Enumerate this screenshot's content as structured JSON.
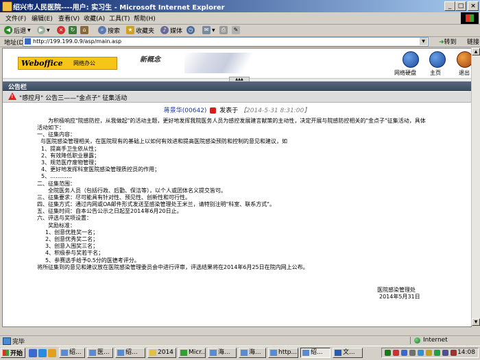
{
  "window": {
    "title": "绍兴市人民医院----用户: 实习生 - Microsoft Internet Explorer",
    "controls": [
      "_",
      "□",
      "×"
    ]
  },
  "menu": [
    "文件(F)",
    "编辑(E)",
    "查看(V)",
    "收藏(A)",
    "工具(T)",
    "帮助(H)"
  ],
  "toolbar": {
    "back": "后退",
    "search": "搜索",
    "favorites": "收藏夹",
    "media": "媒体"
  },
  "address": {
    "label": "地址(D)",
    "url": "http://199.199.0.9/asp/main.asp",
    "go": "转到",
    "links": "链接"
  },
  "banner": {
    "logo": "Weboffice",
    "logo_sub": "网络办公",
    "slogan": "新概念",
    "icons": [
      {
        "label": "网络硬盘",
        "icon": "disk-icon"
      },
      {
        "label": "主页",
        "icon": "home-icon"
      },
      {
        "label": "退出",
        "icon": "exit-icon"
      }
    ]
  },
  "bulletin": {
    "header": "公告栏",
    "subject": "\"感控月\" 公告三——\"金点子\" 征集活动",
    "author": "蒋景华(00642)",
    "published_label": "发表于",
    "date": "【2014-5-31 8:31:00】",
    "body": [
      "为积极响应\"院感防控，从我做起\"的活动主题，更好地发挥我院医务人员为感控发展建言献策的主动性，决定开展与院感防控相关的\"金点子\"征集活动，具体",
      "活动如下：",
      "一、征集内容：",
      "与医院感染管理相关，在医院现有的基础上以如何有效进和提高医院感染预防和控制的意见和建议，如",
      "1、提高手卫生依从性；",
      "2、有效降低职业暴露；",
      "3、规范医疗废物管理；",
      "4、更好地发挥科室医院感染管理质控员的作用；",
      "5、…………",
      "二、征集范围：",
      "全院医务人员（包括行政、后勤、保洁等），以个人或团体名义提交皆可。",
      "三、征集要求：尽可能具有针对性、预见性、创新性和可行性。",
      "四、征集方式：通过内网或OA邮件形式发送至感染管理处王米兰，请特别注明\"科室、联系方式\"。",
      "五、征集时间：自本公告公示之日起至2014年6月20日止。",
      "六、评选与奖项设置：",
      "奖励标准：",
      "1、创意优胜奖一名；",
      "2、创意优秀奖二名；",
      "3、创意入围奖三名；",
      "4、积极参与奖若干名；",
      "5、参赛选手给予0.5分的医德考评分。",
      "将所征集到的意见和建议放在医院感染管理委员会中进行评审，评选结果将在2014年6月25日在院内网上公布。"
    ],
    "signature": "医院感染管理处",
    "sign_date": "2014年5月31日"
  },
  "status": {
    "text": "完毕",
    "zone": "Internet"
  },
  "taskbar": {
    "start": "开始",
    "tasks": [
      "绍...",
      "医...",
      "绍...",
      "2014",
      "Micr...",
      "海...",
      "海...",
      "http...",
      "绍...",
      "文..."
    ],
    "active_task": 8,
    "clock": "14:08"
  }
}
